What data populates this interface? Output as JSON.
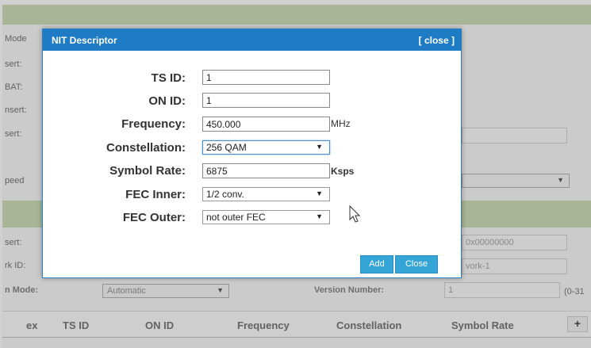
{
  "background": {
    "left_labels": [
      "Mode",
      "sert:",
      "BAT:",
      "nsert:",
      "sert:",
      "peed",
      "sert:",
      "rk ID:",
      "n Mode:"
    ],
    "right_inputs": [
      "0x00000000",
      "vork-1",
      "1"
    ],
    "update_mode_value": "Automatic",
    "version_number_label": "Version Number:",
    "range_hint": "(0-31",
    "table_headers": [
      "ex",
      "TS ID",
      "ON ID",
      "Frequency",
      "Constellation",
      "Symbol Rate"
    ],
    "add_row_label": "+"
  },
  "dialog": {
    "title": "NIT Descriptor",
    "close_label": "[ close ]",
    "fields": {
      "ts_id": {
        "label": "TS ID:",
        "value": "1"
      },
      "on_id": {
        "label": "ON ID:",
        "value": "1"
      },
      "frequency": {
        "label": "Frequency:",
        "value": "450.000",
        "unit": "MHz"
      },
      "constellation": {
        "label": "Constellation:",
        "value": "256 QAM"
      },
      "symbol_rate": {
        "label": "Symbol Rate:",
        "value": "6875",
        "unit": "Ksps"
      },
      "fec_inner": {
        "label": "FEC Inner:",
        "value": "1/2 conv."
      },
      "fec_outer": {
        "label": "FEC Outer:",
        "value": "not outer FEC"
      }
    },
    "add_button": "Add",
    "close_button": "Close"
  },
  "colors": {
    "header_blue": "#1f7bc4",
    "button_blue": "#35a5d8",
    "band_green": "#c8d9ae"
  },
  "icons": {
    "select_arrow": "▼"
  }
}
